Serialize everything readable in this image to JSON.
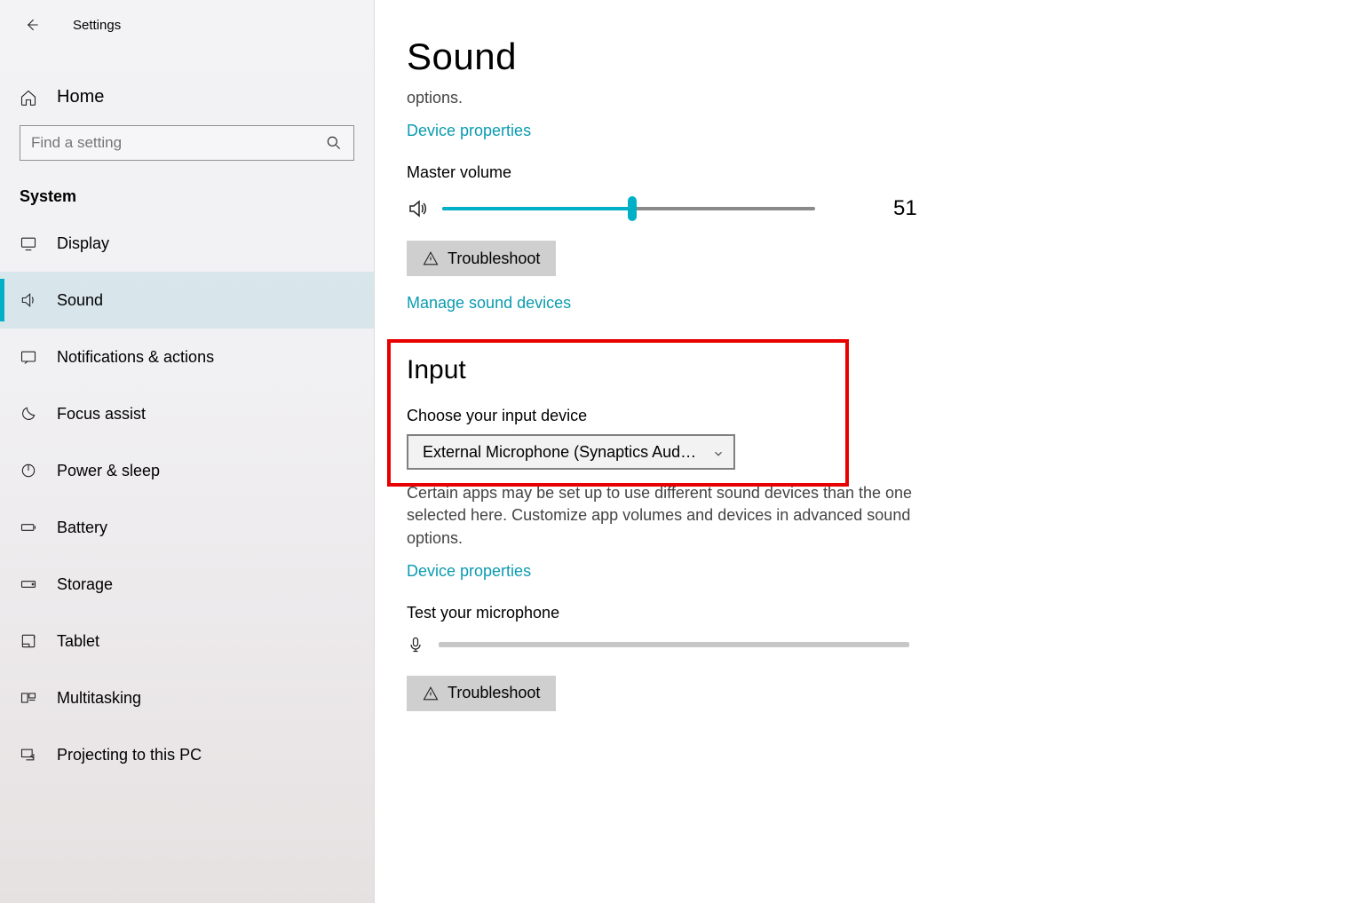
{
  "app": {
    "title": "Settings"
  },
  "sidebar": {
    "home_label": "Home",
    "search_placeholder": "Find a setting",
    "category": "System",
    "items": [
      {
        "label": "Display"
      },
      {
        "label": "Sound"
      },
      {
        "label": "Notifications & actions"
      },
      {
        "label": "Focus assist"
      },
      {
        "label": "Power & sleep"
      },
      {
        "label": "Battery"
      },
      {
        "label": "Storage"
      },
      {
        "label": "Tablet"
      },
      {
        "label": "Multitasking"
      },
      {
        "label": "Projecting to this PC"
      }
    ],
    "selected_index": 1
  },
  "main": {
    "title": "Sound",
    "output_options_trail": "options.",
    "device_properties": "Device properties",
    "master_volume_label": "Master volume",
    "master_volume_value": "51",
    "master_volume_percent": 51,
    "troubleshoot": "Troubleshoot",
    "manage_sound": "Manage sound devices",
    "input_heading": "Input",
    "choose_input_label": "Choose your input device",
    "input_device_selected": "External Microphone (Synaptics Aud…",
    "input_description": "Certain apps may be set up to use different sound devices than the one selected here. Customize app volumes and devices in advanced sound options.",
    "device_properties2": "Device properties",
    "test_mic_label": "Test your microphone",
    "troubleshoot2": "Troubleshoot"
  }
}
